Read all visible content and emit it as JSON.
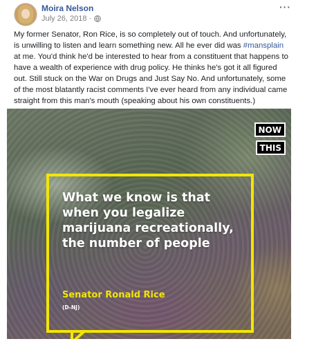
{
  "post": {
    "author": "Moira Nelson",
    "date": "July 26, 2018 ·",
    "privacy_icon": "globe-icon",
    "more_icon": "more-options-icon",
    "more_label": "···",
    "text_before": "My former Senator, Ron Rice, is so completely out of touch. And unfortunately, is unwilling to listen and learn something new. All he ever did was ",
    "hashtag": "#mansplain",
    "text_after": " at me. You'd think he'd be interested to hear from a constituent that happens to have a wealth of experience with drug policy. He thinks he's got it all figured out. Still stuck on the War on Drugs and Just Say No. And unfortunately, some of the most blatantly racist comments I've ever heard from any individual came straight from this man's mouth (speaking about his own constituents.)"
  },
  "media": {
    "badge_line1": "NOW",
    "badge_line2": "THIS",
    "quote": "What we know is that when you legalize marijuana recreationally, the number of people",
    "attribution_name": "Senator Ronald Rice",
    "attribution_party": "(D-NJ)",
    "accent_color": "#f3e600"
  },
  "colors": {
    "link": "#365899",
    "text": "#1c1e21",
    "meta": "#7f7f7f"
  }
}
